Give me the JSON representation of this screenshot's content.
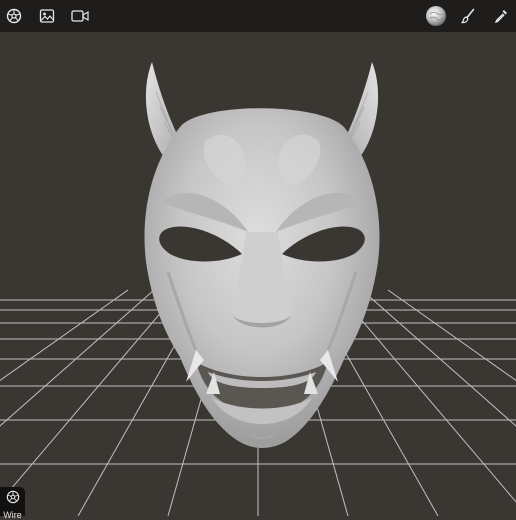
{
  "toolbar": {
    "left_icons": [
      "mask-tool-icon",
      "gallery-icon",
      "camera-icon"
    ],
    "right_icons": [
      "material-sphere-icon",
      "brush-icon",
      "color-picker-icon"
    ]
  },
  "viewport": {
    "background_color": "#3a3632",
    "grid_color": "#d8d8d8",
    "model_color": "#c8c8c8"
  },
  "wire_button": {
    "label": "Wire"
  }
}
